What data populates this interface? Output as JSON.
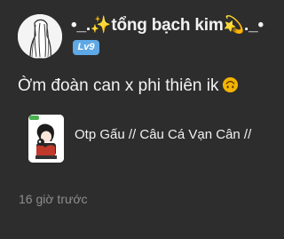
{
  "post": {
    "username": "•_.✨tổng bạch kim💫._•",
    "level_badge": "Lv9",
    "text": "Ờm đoàn can x phi thiên ik",
    "text_emoji": "upside-down-face-emoji",
    "shared_item": {
      "title": "Otp Gấu // Câu Cá Vạn Cân //"
    },
    "timestamp": "16 giờ trước"
  },
  "colors": {
    "background": "#2d2d2d",
    "text": "#f2f2f2",
    "muted": "#8e8e8e",
    "badge": "#5fa8e6",
    "emoji": "#f4b400"
  }
}
